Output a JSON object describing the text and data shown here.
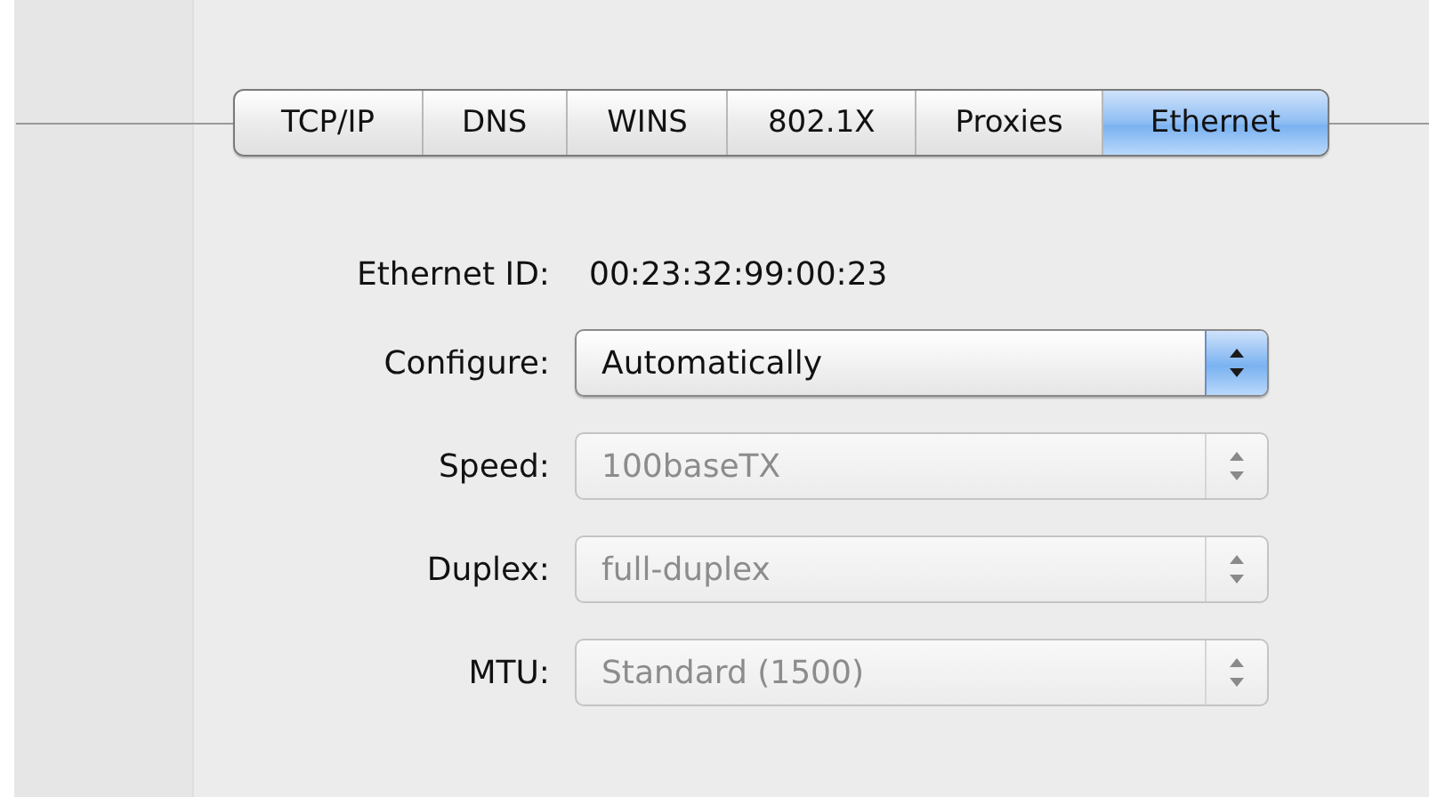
{
  "tabs": [
    {
      "label": "TCP/IP",
      "selected": false
    },
    {
      "label": "DNS",
      "selected": false
    },
    {
      "label": "WINS",
      "selected": false
    },
    {
      "label": "802.1X",
      "selected": false
    },
    {
      "label": "Proxies",
      "selected": false
    },
    {
      "label": "Ethernet",
      "selected": true
    }
  ],
  "ethernet_id": {
    "label": "Ethernet ID:",
    "value": "00:23:32:99:00:23"
  },
  "popups": [
    {
      "label": "Configure:",
      "value": "Automatically",
      "disabled": false
    },
    {
      "label": "Speed:",
      "value": "100baseTX",
      "disabled": true
    },
    {
      "label": "Duplex:",
      "value": "full-duplex",
      "disabled": true
    },
    {
      "label": "MTU:",
      "value": "Standard  (1500)",
      "disabled": true
    }
  ]
}
